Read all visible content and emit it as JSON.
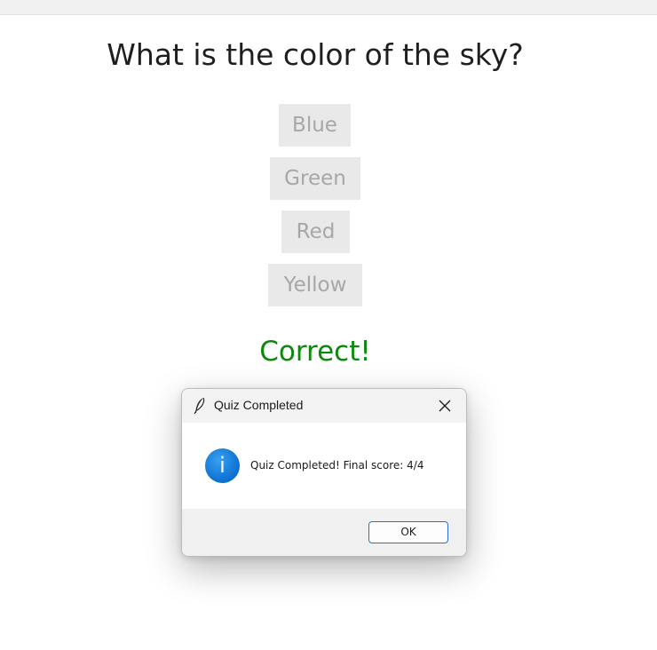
{
  "quiz": {
    "question": "What is the color of the sky?",
    "options": [
      "Blue",
      "Green",
      "Red",
      "Yellow"
    ],
    "feedback": "Correct!",
    "feedback_color": "#0a8a0a"
  },
  "dialog": {
    "title": "Quiz Completed",
    "title_icon": "feather-icon",
    "message_icon": "info-icon",
    "message": "Quiz Completed! Final score: 4/4",
    "ok_label": "OK",
    "close_icon": "close-icon"
  }
}
